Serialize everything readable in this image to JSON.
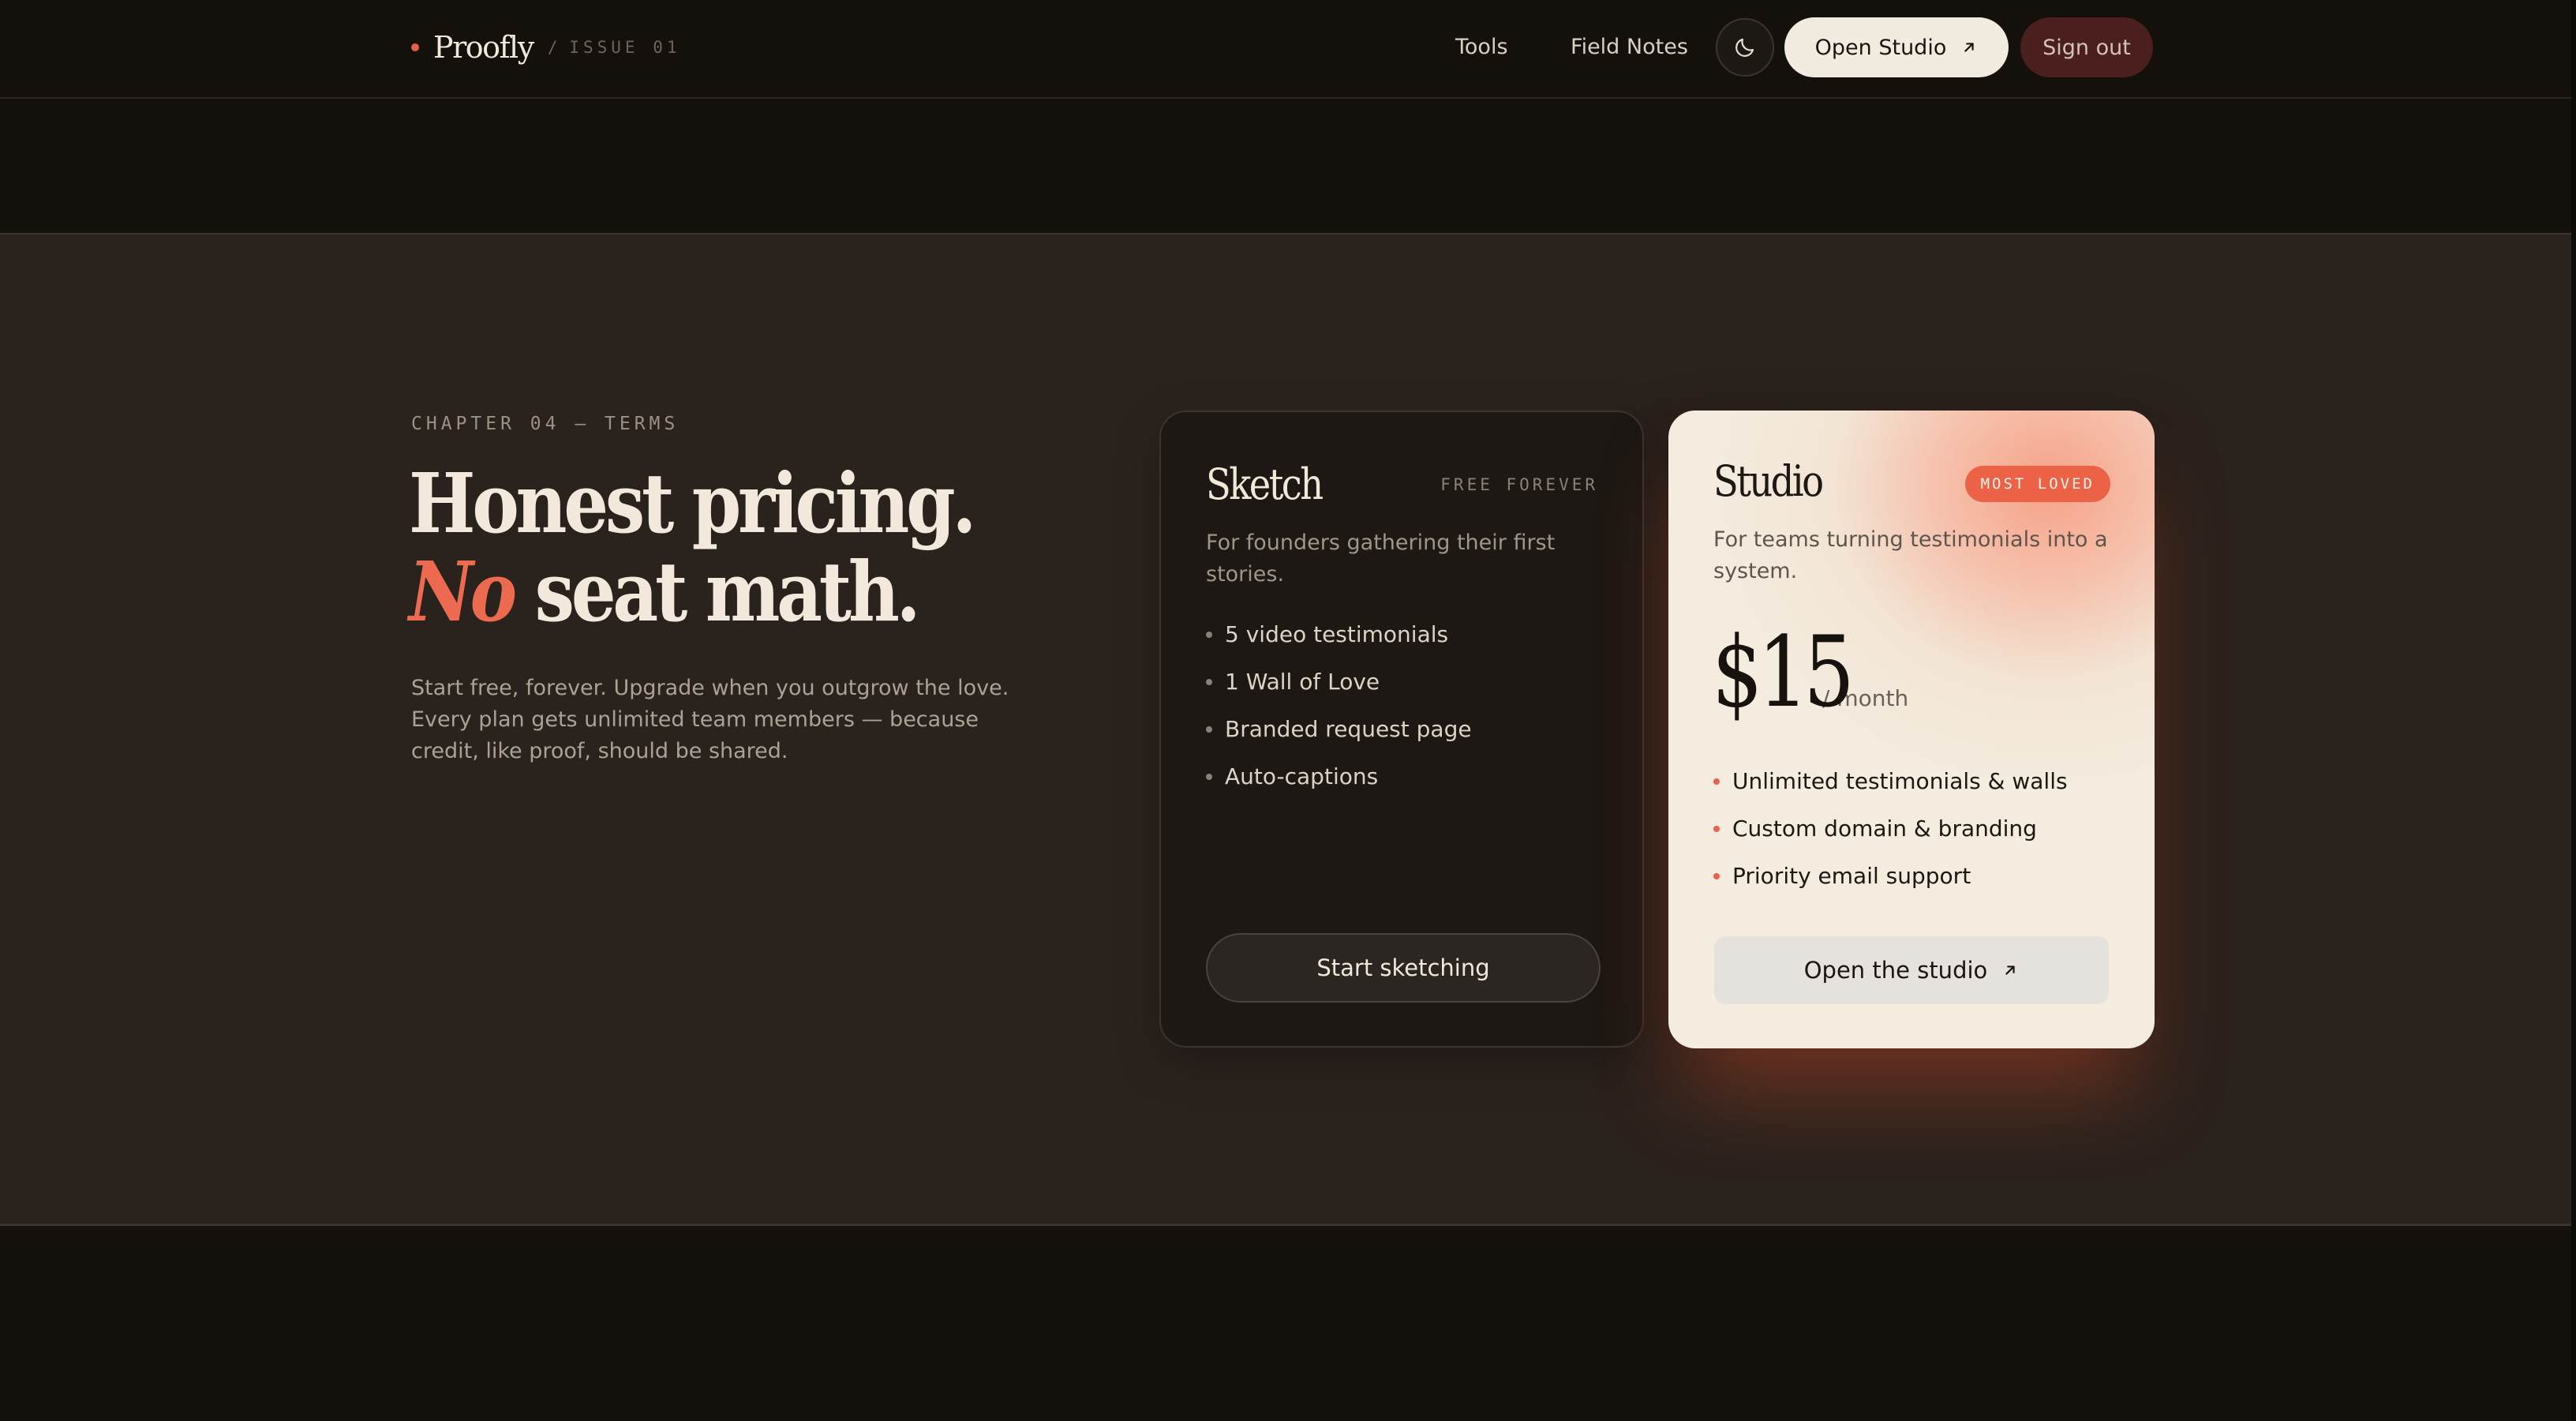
{
  "header": {
    "brand": "Proofly",
    "separator": "/",
    "issue": "ISSUE 01",
    "nav": [
      "Tools",
      "Field Notes"
    ],
    "theme_icon": "moon-icon",
    "open_studio": "Open Studio",
    "sign_out": "Sign out"
  },
  "pricing": {
    "eyebrow": "CHAPTER 04 — TERMS",
    "headline_line1": "Honest pricing.",
    "headline_em": "No",
    "headline_rest": " seat math.",
    "lede": "Start free, forever. Upgrade when you outgrow the love. Every plan gets unlimited team members — because credit, like proof, should be shared.",
    "plans": [
      {
        "name": "Sketch",
        "tag": "FREE FOREVER",
        "description": "For founders gathering their first stories.",
        "features": [
          "5 video testimonials",
          "1 Wall of Love",
          "Branded request page",
          "Auto-captions"
        ],
        "cta": "Start sketching"
      },
      {
        "name": "Studio",
        "badge": "MOST LOVED",
        "description": "For teams turning testimonials into a system.",
        "price": "$15",
        "period": "/ month",
        "features": [
          "Unlimited testimonials & walls",
          "Custom domain & branding",
          "Priority email support"
        ],
        "cta": "Open the studio"
      }
    ]
  },
  "colors": {
    "background": "#14110d",
    "section": "#2a221d",
    "accent": "#ec6247",
    "cream": "#f3ecdf"
  }
}
